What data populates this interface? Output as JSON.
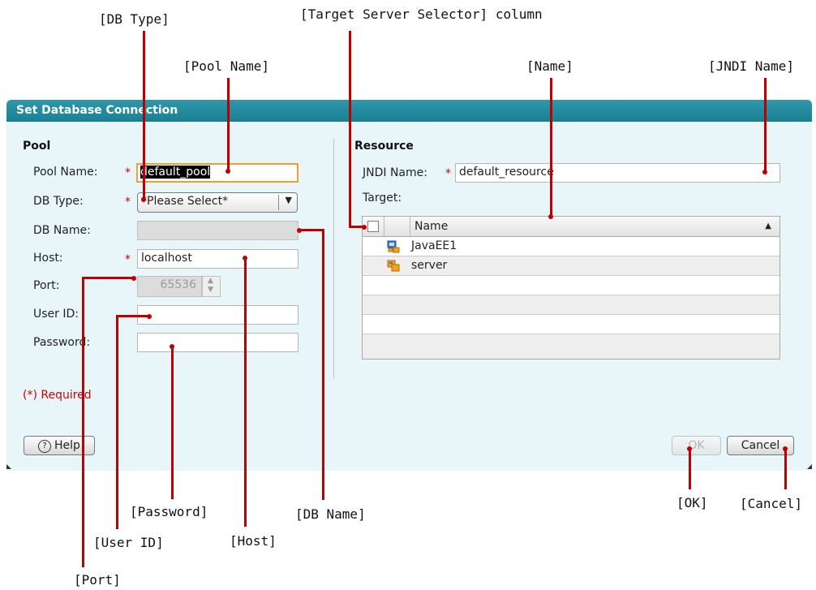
{
  "callouts": {
    "db_type": "[DB Type]",
    "target_column": "[Target Server Selector] column",
    "pool_name": "[Pool Name]",
    "name": "[Name]",
    "jndi_name": "[JNDI Name]",
    "password": "[Password]",
    "db_name": "[DB Name]",
    "ok": "[OK]",
    "cancel": "[Cancel]",
    "user_id": "[User ID]",
    "host": "[Host]",
    "port": "[Port]"
  },
  "dialog": {
    "title": "Set Database Connection",
    "pool": {
      "heading": "Pool",
      "pool_name_label": "Pool Name:",
      "pool_name_value": "default_pool",
      "db_type_label": "DB Type:",
      "db_type_value": "*Please Select*",
      "db_name_label": "DB Name:",
      "db_name_value": "",
      "host_label": "Host:",
      "host_value": "localhost",
      "port_label": "Port:",
      "port_value": "65536",
      "user_id_label": "User ID:",
      "user_id_value": "",
      "password_label": "Password:",
      "password_value": "",
      "required_asterisk": "*",
      "required_note": "(*) Required"
    },
    "resource": {
      "heading": "Resource",
      "jndi_label": "JNDI Name:",
      "jndi_value": "default_resource",
      "target_label": "Target:",
      "table": {
        "header_name": "Name",
        "sort_indicator": "▲",
        "rows": [
          "JavaEE1",
          "server"
        ]
      }
    },
    "buttons": {
      "help": "Help",
      "help_glyph": "?",
      "ok": "OK",
      "cancel": "Cancel"
    }
  },
  "colors": {
    "title_bar": "#1b7f92",
    "dialog_bg": "#e8f5f9",
    "callout_line": "#c00000",
    "required": "#d00000"
  }
}
